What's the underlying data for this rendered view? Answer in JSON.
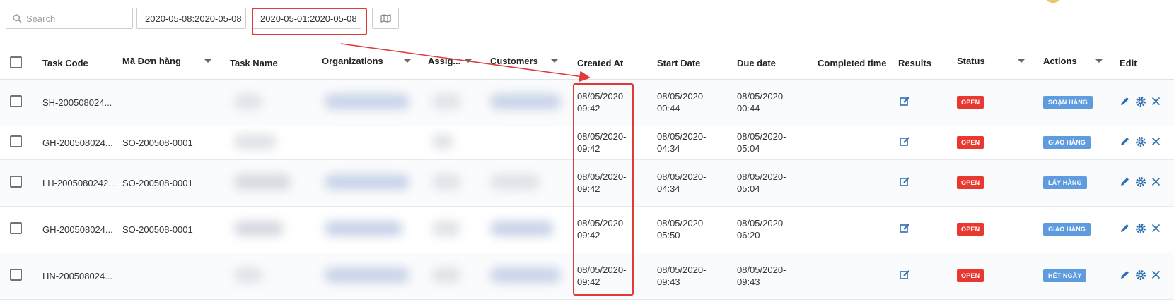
{
  "toolbar": {
    "search_placeholder": "Search",
    "date_range_1": "2020-05-08:2020-05-08",
    "date_range_2": "2020-05-01:2020-05-08"
  },
  "table": {
    "headers": {
      "task_code": "Task Code",
      "ma_don_hang": "Mã Đơn hàng",
      "task_name": "Task Name",
      "organizations": "Organizations",
      "assignee": "Assig...",
      "customers": "Customers",
      "created_at": "Created At",
      "start_date": "Start Date",
      "due_date": "Due date",
      "completed_time": "Completed time",
      "results": "Results",
      "status": "Status",
      "actions": "Actions",
      "edit": "Edit"
    },
    "rows": [
      {
        "task_code": "SH-200508024...",
        "order": "",
        "created_date": "08/05/2020-",
        "created_time": "09:42",
        "start_date": "08/05/2020-",
        "start_time": "00:44",
        "due_date": "08/05/2020-",
        "due_time": "00:44",
        "status": "OPEN",
        "action": "SOẠN HÀNG"
      },
      {
        "task_code": "GH-200508024...",
        "order": "SO-200508-0001",
        "created_date": "08/05/2020-",
        "created_time": "09:42",
        "start_date": "08/05/2020-",
        "start_time": "04:34",
        "due_date": "08/05/2020-",
        "due_time": "05:04",
        "status": "OPEN",
        "action": "GIAO HÀNG"
      },
      {
        "task_code": "LH-2005080242...",
        "order": "SO-200508-0001",
        "created_date": "08/05/2020-",
        "created_time": "09:42",
        "start_date": "08/05/2020-",
        "start_time": "04:34",
        "due_date": "08/05/2020-",
        "due_time": "05:04",
        "status": "OPEN",
        "action": "LẤY HÀNG"
      },
      {
        "task_code": "GH-200508024...",
        "order": "SO-200508-0001",
        "created_date": "08/05/2020-",
        "created_time": "09:42",
        "start_date": "08/05/2020-",
        "start_time": "05:50",
        "due_date": "08/05/2020-",
        "due_time": "06:20",
        "status": "OPEN",
        "action": "GIAO HÀNG"
      },
      {
        "task_code": "HN-200508024...",
        "order": "",
        "created_date": "08/05/2020-",
        "created_time": "09:42",
        "start_date": "08/05/2020-",
        "start_time": "09:43",
        "due_date": "08/05/2020-",
        "due_time": "09:43",
        "status": "OPEN",
        "action": "HẾT NGÀY"
      }
    ]
  },
  "colors": {
    "open_badge": "#e8382f",
    "action_badge": "#5e9bdf",
    "annotation": "#e03b3b",
    "icon_blue": "#2f6fb0"
  }
}
